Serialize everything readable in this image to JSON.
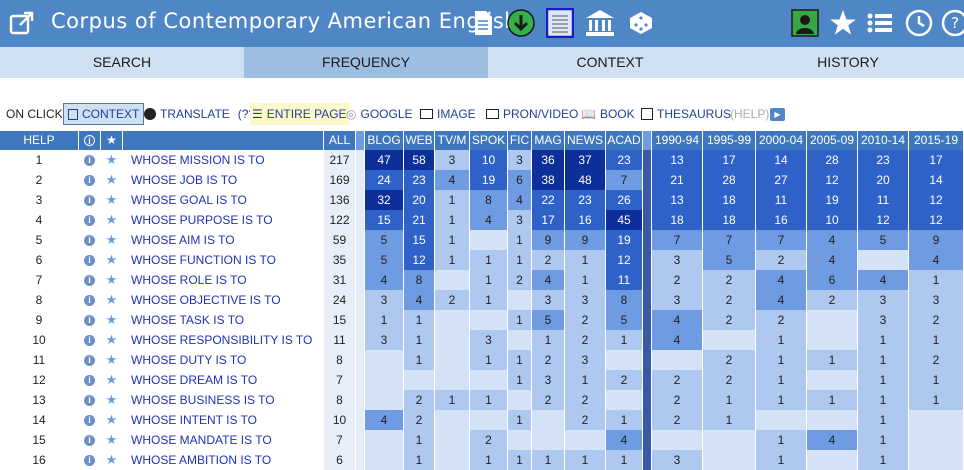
{
  "app": {
    "title": "Corpus of Contemporary American English"
  },
  "toolbar_icons": [
    "external-link-icon",
    "document-icon",
    "download-icon",
    "list-grid-icon",
    "museum-icon",
    "dice-icon",
    "user-icon",
    "star-icon",
    "list-icon",
    "history-icon",
    "help-icon"
  ],
  "tabs": [
    {
      "label": "SEARCH",
      "active": false
    },
    {
      "label": "FREQUENCY",
      "active": true
    },
    {
      "label": "CONTEXT",
      "active": false
    },
    {
      "label": "HISTORY",
      "active": false
    }
  ],
  "onclick": {
    "label": "ON CLICK:",
    "items": [
      {
        "label": "CONTEXT"
      },
      {
        "label": "TRANSLATE"
      },
      {
        "label": "(??)"
      },
      {
        "label": "ENTIRE PAGE"
      },
      {
        "label": "GOOGLE"
      },
      {
        "label": "IMAGE"
      },
      {
        "label": "PRON/VIDEO"
      },
      {
        "label": "BOOK"
      },
      {
        "label": "THESAURUS"
      },
      {
        "label": "(HELP)"
      }
    ]
  },
  "table": {
    "header": {
      "help": "HELP",
      "all": "ALL",
      "genres": [
        "BLOG",
        "WEB",
        "TV/M",
        "SPOK",
        "FIC",
        "MAG",
        "NEWS",
        "ACAD"
      ],
      "periods": [
        "1990-94",
        "1995-99",
        "2000-04",
        "2005-09",
        "2010-14",
        "2015-19"
      ]
    },
    "rows": [
      {
        "n": "1",
        "word": "WHOSE MISSION IS TO",
        "all": "217",
        "g": [
          "47",
          "58",
          "3",
          "10",
          "3",
          "36",
          "37",
          "23"
        ],
        "p": [
          "13",
          "17",
          "14",
          "28",
          "23",
          "17"
        ]
      },
      {
        "n": "2",
        "word": "WHOSE JOB IS TO",
        "all": "169",
        "g": [
          "24",
          "23",
          "4",
          "19",
          "6",
          "38",
          "48",
          "7"
        ],
        "p": [
          "21",
          "28",
          "27",
          "12",
          "20",
          "14"
        ]
      },
      {
        "n": "3",
        "word": "WHOSE GOAL IS TO",
        "all": "136",
        "g": [
          "32",
          "20",
          "1",
          "8",
          "4",
          "22",
          "23",
          "26"
        ],
        "p": [
          "13",
          "18",
          "11",
          "19",
          "11",
          "12"
        ]
      },
      {
        "n": "4",
        "word": "WHOSE PURPOSE IS TO",
        "all": "122",
        "g": [
          "15",
          "21",
          "1",
          "4",
          "3",
          "17",
          "16",
          "45"
        ],
        "p": [
          "18",
          "18",
          "16",
          "10",
          "12",
          "12"
        ]
      },
      {
        "n": "5",
        "word": "WHOSE AIM IS TO",
        "all": "59",
        "g": [
          "5",
          "15",
          "1",
          "",
          "1",
          "9",
          "9",
          "19"
        ],
        "p": [
          "7",
          "7",
          "7",
          "4",
          "5",
          "9"
        ]
      },
      {
        "n": "6",
        "word": "WHOSE FUNCTION IS TO",
        "all": "35",
        "g": [
          "5",
          "12",
          "1",
          "1",
          "1",
          "2",
          "1",
          "12"
        ],
        "p": [
          "3",
          "5",
          "2",
          "4",
          "",
          "4"
        ]
      },
      {
        "n": "7",
        "word": "WHOSE ROLE IS TO",
        "all": "31",
        "g": [
          "4",
          "8",
          "",
          "1",
          "2",
          "4",
          "1",
          "11"
        ],
        "p": [
          "2",
          "2",
          "4",
          "6",
          "4",
          "1"
        ]
      },
      {
        "n": "8",
        "word": "WHOSE OBJECTIVE IS TO",
        "all": "24",
        "g": [
          "3",
          "4",
          "2",
          "1",
          "",
          "3",
          "3",
          "8"
        ],
        "p": [
          "3",
          "2",
          "4",
          "2",
          "3",
          "3"
        ]
      },
      {
        "n": "9",
        "word": "WHOSE TASK IS TO",
        "all": "15",
        "g": [
          "1",
          "1",
          "",
          "",
          "1",
          "5",
          "2",
          "5"
        ],
        "p": [
          "4",
          "2",
          "2",
          "",
          "3",
          "2"
        ]
      },
      {
        "n": "10",
        "word": "WHOSE RESPONSIBILITY IS TO",
        "all": "11",
        "g": [
          "3",
          "1",
          "",
          "3",
          "",
          "1",
          "2",
          "1"
        ],
        "p": [
          "4",
          "",
          "1",
          "",
          "1",
          "1"
        ]
      },
      {
        "n": "11",
        "word": "WHOSE DUTY IS TO",
        "all": "8",
        "g": [
          "",
          "1",
          "",
          "1",
          "1",
          "2",
          "3",
          ""
        ],
        "p": [
          "",
          "2",
          "1",
          "1",
          "1",
          "2"
        ]
      },
      {
        "n": "12",
        "word": "WHOSE DREAM IS TO",
        "all": "7",
        "g": [
          "",
          "",
          "",
          "",
          "1",
          "3",
          "1",
          "2"
        ],
        "p": [
          "2",
          "2",
          "1",
          "",
          "1",
          "1"
        ]
      },
      {
        "n": "13",
        "word": "WHOSE BUSINESS IS TO",
        "all": "8",
        "g": [
          "",
          "2",
          "1",
          "1",
          "",
          "2",
          "2",
          ""
        ],
        "p": [
          "2",
          "1",
          "1",
          "1",
          "1",
          "1"
        ]
      },
      {
        "n": "14",
        "word": "WHOSE INTENT IS TO",
        "all": "10",
        "g": [
          "4",
          "2",
          "",
          "",
          "1",
          "",
          "2",
          "1"
        ],
        "p": [
          "2",
          "1",
          "",
          "",
          "1",
          ""
        ]
      },
      {
        "n": "15",
        "word": "WHOSE MANDATE IS TO",
        "all": "7",
        "g": [
          "",
          "1",
          "",
          "2",
          "",
          "",
          "",
          "4"
        ],
        "p": [
          "",
          "",
          "1",
          "4",
          "1",
          ""
        ]
      },
      {
        "n": "16",
        "word": "WHOSE AMBITION IS TO",
        "all": "6",
        "g": [
          "",
          "1",
          "",
          "1",
          "1",
          "1",
          "1",
          "1"
        ],
        "p": [
          "3",
          "",
          "1",
          "",
          "1",
          ""
        ]
      }
    ]
  },
  "colors": {
    "dark": "#0d2f9a",
    "mid": "#2f62c8",
    "light": "#6f9be2",
    "pale": "#aec8f0",
    "faint": "#d3e2f7",
    "header": "#3f77bf",
    "accent": "#4f86c6"
  }
}
